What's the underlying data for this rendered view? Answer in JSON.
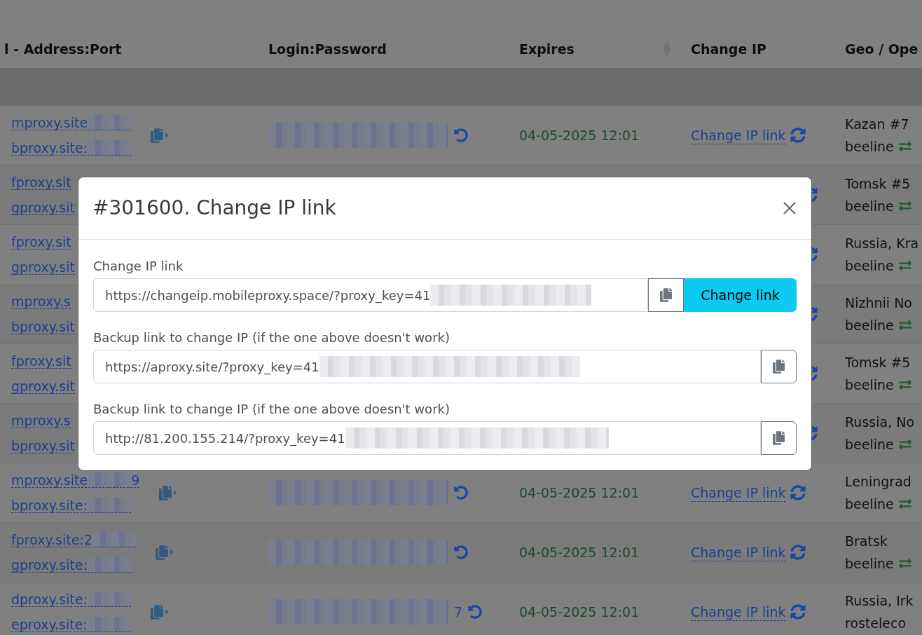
{
  "table": {
    "columns": [
      {
        "label": "l - Address:Port",
        "sortable": false
      },
      {
        "label": "Login:Password",
        "sortable": false
      },
      {
        "label": "Expires",
        "sortable": true
      },
      {
        "label": "Change IP",
        "sortable": false
      },
      {
        "label": "Geo / Ope",
        "sortable": false
      }
    ],
    "rows": [
      {
        "covered": false,
        "addresses": [
          {
            "text": "mproxy.site",
            "redacted": true
          },
          {
            "text": "bproxy.site:",
            "redacted": true
          }
        ],
        "password": {
          "redacted": true
        },
        "expires": "04-05-2025 12:01",
        "change_ip": "Change IP link",
        "geo": "Kazan #7",
        "operator": "beeline",
        "swap_icon": true
      },
      {
        "covered": true,
        "addresses": [
          {
            "text": "fproxy.sit",
            "redacted": false
          },
          {
            "text": "gproxy.sit",
            "redacted": false
          }
        ],
        "geo": "Tomsk #5",
        "operator": "beeline",
        "swap_icon": true
      },
      {
        "covered": true,
        "addresses": [
          {
            "text": "fproxy.sit",
            "redacted": false
          },
          {
            "text": "gproxy.sit",
            "redacted": false
          }
        ],
        "geo": "Russia, Kra",
        "operator": "beeline",
        "swap_icon": true
      },
      {
        "covered": true,
        "addresses": [
          {
            "text": "mproxy.s",
            "redacted": false
          },
          {
            "text": "bproxy.sit",
            "redacted": false
          }
        ],
        "geo": "Nizhnii No",
        "operator": "beeline",
        "swap_icon": true
      },
      {
        "covered": true,
        "addresses": [
          {
            "text": "fproxy.sit",
            "redacted": false
          },
          {
            "text": "gproxy.sit",
            "redacted": false
          }
        ],
        "geo": "Tomsk #5",
        "operator": "beeline",
        "swap_icon": true
      },
      {
        "covered": true,
        "addresses": [
          {
            "text": "mproxy.s",
            "redacted": false
          },
          {
            "text": "bproxy.sit",
            "redacted": false
          }
        ],
        "geo": "Russia, No",
        "operator": "beeline",
        "swap_icon": true
      },
      {
        "covered": false,
        "addresses": [
          {
            "text": "mproxy.site",
            "redacted": true,
            "tail": "9"
          },
          {
            "text": "bproxy.site:",
            "redacted": true
          }
        ],
        "password": {
          "redacted": true
        },
        "expires": "04-05-2025 12:01",
        "change_ip": "Change IP link",
        "geo": "Leningrad",
        "operator": "beeline",
        "swap_icon": true
      },
      {
        "covered": false,
        "addresses": [
          {
            "text": "fproxy.site:2",
            "redacted": true
          },
          {
            "text": "gproxy.site:",
            "redacted": true
          }
        ],
        "password": {
          "redacted": true
        },
        "expires": "04-05-2025 12:01",
        "change_ip": "Change IP link",
        "geo": "Bratsk",
        "operator": "beeline",
        "swap_icon": true
      },
      {
        "covered": false,
        "addresses": [
          {
            "text": "dproxy.site:",
            "redacted": true
          },
          {
            "text": "eproxy.site:",
            "redacted": true
          }
        ],
        "password": {
          "redacted": true,
          "tail": "7"
        },
        "expires": "04-05-2025 12:01",
        "change_ip": "Change IP link",
        "geo": "Russia, Irk",
        "operator": "rosteleco",
        "swap_icon": false
      }
    ]
  },
  "dialog": {
    "title": "#301600. Change IP link",
    "fields": [
      {
        "label": "Change IP link",
        "value": "https://changeip.mobileproxy.space/?proxy_key=41",
        "redacted": true,
        "buttons": [
          {
            "kind": "copy"
          },
          {
            "kind": "action",
            "label": "Change link"
          }
        ]
      },
      {
        "label": "Backup link to change IP (if the one above doesn't work)",
        "value": "https://aproxy.site/?proxy_key=41",
        "redacted": true,
        "buttons": [
          {
            "kind": "copy"
          }
        ]
      },
      {
        "label": "Backup link to change IP (if the one above doesn't work)",
        "value": "http://81.200.155.214/?proxy_key=41",
        "redacted": true,
        "buttons": [
          {
            "kind": "copy"
          }
        ]
      }
    ]
  }
}
